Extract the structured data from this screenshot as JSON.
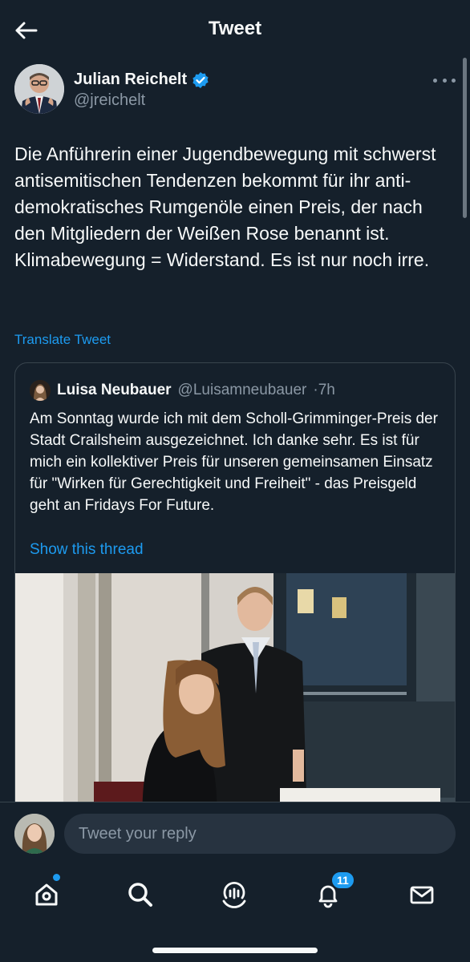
{
  "header": {
    "title": "Tweet"
  },
  "author": {
    "name": "Julian Reichelt",
    "handle": "@jreichelt",
    "verified": true
  },
  "tweet": {
    "text": "Die Anführerin einer Jugendbewegung mit schwerst antisemitischen Tendenzen bekommt für ihr anti-demokratisches Rumgenöle einen Preis, der nach den Mitgliedern der Weißen Rose benannt ist. Klimabewegung = Widerstand. Es ist nur noch irre.",
    "translate_label": "Translate Tweet"
  },
  "quoted": {
    "name": "Luisa Neubauer",
    "handle": "@Luisamneubauer",
    "time": "·7h",
    "text": "Am Sonntag wurde ich mit dem Scholl-Grimminger-Preis der Stadt Crailsheim ausgezeichnet. Ich danke sehr. Es ist für mich ein kollektiver Preis für unseren gemeinsamen Einsatz für \"Wirken für Gerechtigkeit und Freiheit\" - das Preisgeld geht an Fridays For Future.",
    "thread_label": "Show this thread"
  },
  "reply": {
    "placeholder": "Tweet your reply"
  },
  "tabs": {
    "items": [
      "home-icon",
      "search-icon",
      "spaces-icon",
      "notifications-icon",
      "messages-icon"
    ],
    "notifications_count": "11"
  },
  "colors": {
    "background": "#15202b",
    "accent": "#1d9bf0",
    "muted": "#8b98a5",
    "border": "#38444d"
  }
}
